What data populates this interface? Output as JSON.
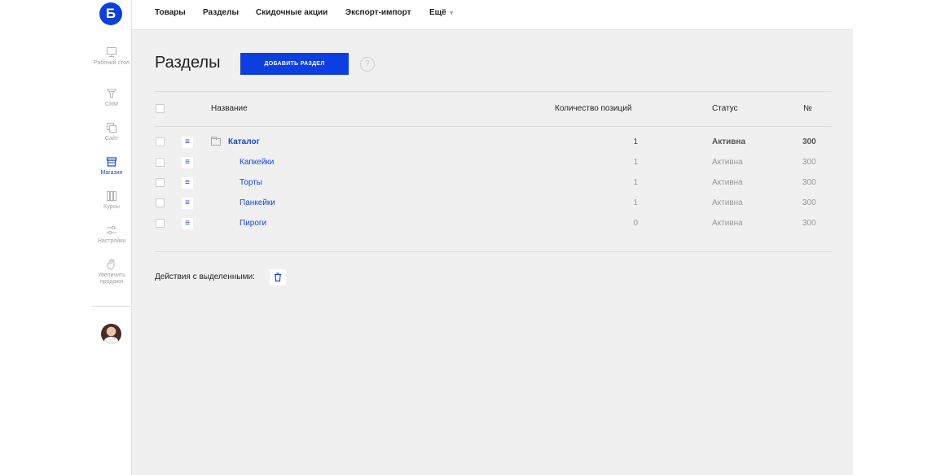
{
  "sidebar": {
    "logo": "Б",
    "items": [
      {
        "label": "Рабочий стол",
        "icon": "monitor-icon"
      },
      {
        "label": "CRM",
        "icon": "funnel-icon"
      },
      {
        "label": "Сайт",
        "icon": "pages-icon"
      },
      {
        "label": "Магазин",
        "icon": "store-icon",
        "active": true
      },
      {
        "label": "Курсы",
        "icon": "books-icon"
      },
      {
        "label": "Настройки",
        "icon": "sliders-icon"
      },
      {
        "label": "Увеличить продажи",
        "icon": "hand-icon"
      }
    ]
  },
  "topmenu": {
    "items": [
      "Товары",
      "Разделы",
      "Скидочные акции",
      "Экспорт-импорт",
      "Ещё"
    ]
  },
  "page": {
    "title": "Разделы",
    "add_button": "ДОБАВИТЬ РАЗДЕЛ",
    "help": "?"
  },
  "table": {
    "headers": {
      "name": "Название",
      "count": "Количество позиций",
      "status": "Статус",
      "num": "№"
    },
    "rows": [
      {
        "name": "Каталог",
        "count": "1",
        "status": "Активна",
        "num": "300",
        "root": true
      },
      {
        "name": "Капкейки",
        "count": "1",
        "status": "Активна",
        "num": "300"
      },
      {
        "name": "Торты",
        "count": "1",
        "status": "Активна",
        "num": "300"
      },
      {
        "name": "Панкейки",
        "count": "1",
        "status": "Активна",
        "num": "300"
      },
      {
        "name": "Пироги",
        "count": "0",
        "status": "Активна",
        "num": "300"
      }
    ]
  },
  "bulk_actions": {
    "label": "Действия с выделенными:"
  },
  "colors": {
    "accent": "#0b3fe0",
    "link": "#1546e0",
    "background": "#f0f0f0"
  }
}
